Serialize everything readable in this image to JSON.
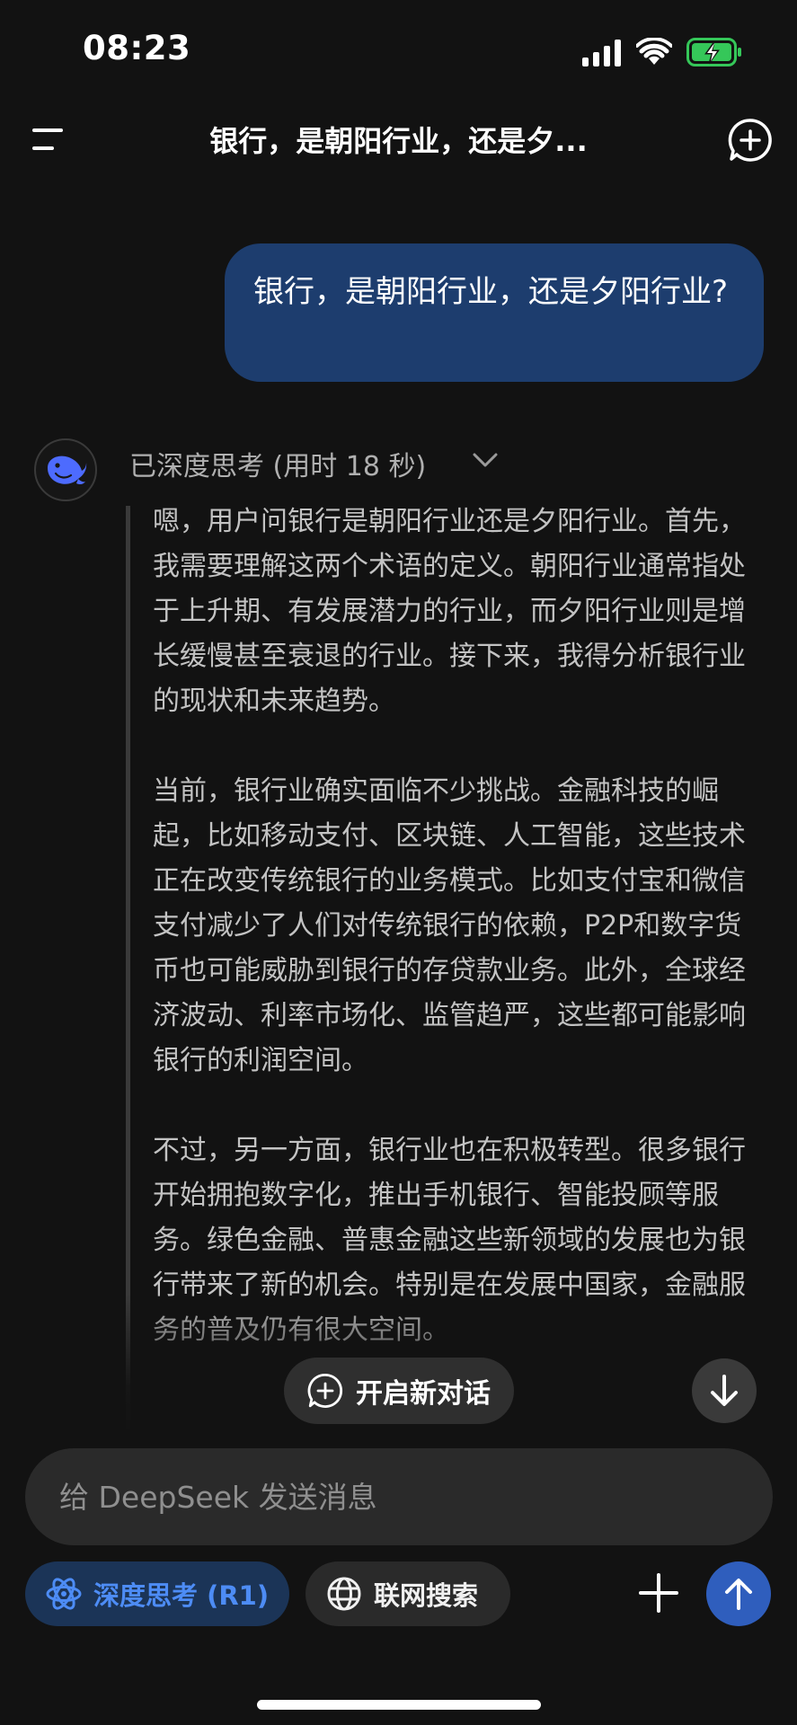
{
  "status_bar": {
    "time": "08:23"
  },
  "header": {
    "title": "银行，是朝阳行业，还是夕..."
  },
  "user_message": {
    "text": "银行，是朝阳行业，还是夕阳行业?"
  },
  "assistant": {
    "thinking_label": "已深度思考 (用时 18 秒)",
    "thinking_paragraphs": [
      "嗯，用户问银行是朝阳行业还是夕阳行业。首先，我需要理解这两个术语的定义。朝阳行业通常指处于上升期、有发展潜力的行业，而夕阳行业则是增长缓慢甚至衰退的行业。接下来，我得分析银行业的现状和未来趋势。",
      "当前，银行业确实面临不少挑战。金融科技的崛起，比如移动支付、区块链、人工智能，这些技术正在改变传统银行的业务模式。比如支付宝和微信支付减少了人们对传统银行的依赖，P2P和数字货币也可能威胁到银行的存贷款业务。此外，全球经济波动、利率市场化、监管趋严，这些都可能影响银行的利润空间。",
      "不过，另一方面，银行业也在积极转型。很多银行开始拥抱数字化，推出手机银行、智能投顾等服务。绿色金融、普惠金融这些新领域的发展也为银行带来了新的机会。特别是在发展中国家，金融服务的普及仍有很大空间。"
    ]
  },
  "floating": {
    "new_dialog_label": "开启新对话"
  },
  "composer": {
    "placeholder": "给 DeepSeek 发送消息",
    "deep_think_label": "深度思考 (R1)",
    "web_search_label": "联网搜索"
  },
  "colors": {
    "background": "#121212",
    "user_bubble": "#1d3d6e",
    "accent_blue": "#4d8cf5",
    "send_button": "#2f5ebd",
    "battery_green": "#35c759"
  }
}
